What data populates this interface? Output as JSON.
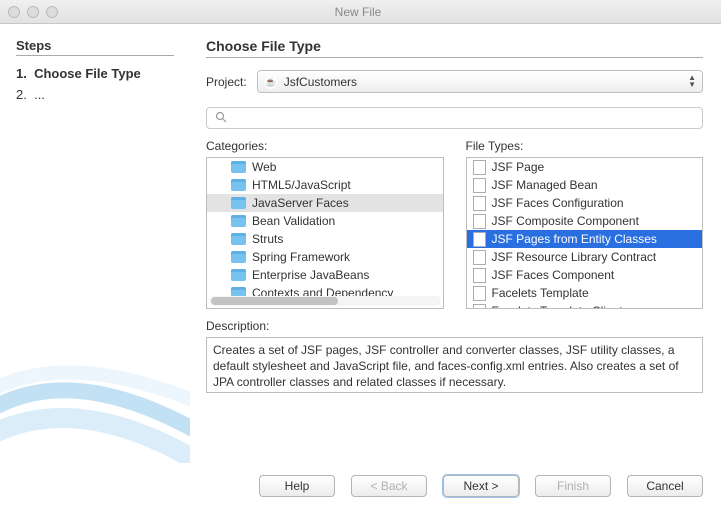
{
  "window": {
    "title": "New File"
  },
  "sidebar": {
    "heading": "Steps",
    "steps": [
      {
        "num": "1.",
        "label": "Choose File Type",
        "current": true
      },
      {
        "num": "2.",
        "label": "...",
        "current": false
      }
    ]
  },
  "main": {
    "heading": "Choose File Type",
    "project_label": "Project:",
    "project_value": "JsfCustomers",
    "search_value": "",
    "categories_label": "Categories:",
    "file_types_label": "File Types:",
    "description_label": "Description:",
    "description_text": "Creates a set of JSF pages, JSF controller and converter classes, JSF utility classes, a default stylesheet and JavaScript file, and faces-config.xml entries. Also creates a set of JPA controller classes and related classes if necessary."
  },
  "categories": [
    {
      "label": "Web",
      "depth": 1,
      "selected": false
    },
    {
      "label": "HTML5/JavaScript",
      "depth": 1,
      "selected": false
    },
    {
      "label": "JavaServer Faces",
      "depth": 1,
      "selected": true
    },
    {
      "label": "Bean Validation",
      "depth": 1,
      "selected": false
    },
    {
      "label": "Struts",
      "depth": 1,
      "selected": false
    },
    {
      "label": "Spring Framework",
      "depth": 1,
      "selected": false
    },
    {
      "label": "Enterprise JavaBeans",
      "depth": 1,
      "selected": false
    },
    {
      "label": "Contexts and Dependency",
      "depth": 1,
      "selected": false
    }
  ],
  "file_types": [
    {
      "label": "JSF Page",
      "selected": false
    },
    {
      "label": "JSF Managed Bean",
      "selected": false
    },
    {
      "label": "JSF Faces Configuration",
      "selected": false
    },
    {
      "label": "JSF Composite Component",
      "selected": false
    },
    {
      "label": "JSF Pages from Entity Classes",
      "selected": true
    },
    {
      "label": "JSF Resource Library Contract",
      "selected": false
    },
    {
      "label": "JSF Faces Component",
      "selected": false
    },
    {
      "label": "Facelets Template",
      "selected": false
    },
    {
      "label": "Facelets Template Client",
      "selected": false
    }
  ],
  "buttons": {
    "help": "Help",
    "back": "< Back",
    "next": "Next >",
    "finish": "Finish",
    "cancel": "Cancel"
  }
}
